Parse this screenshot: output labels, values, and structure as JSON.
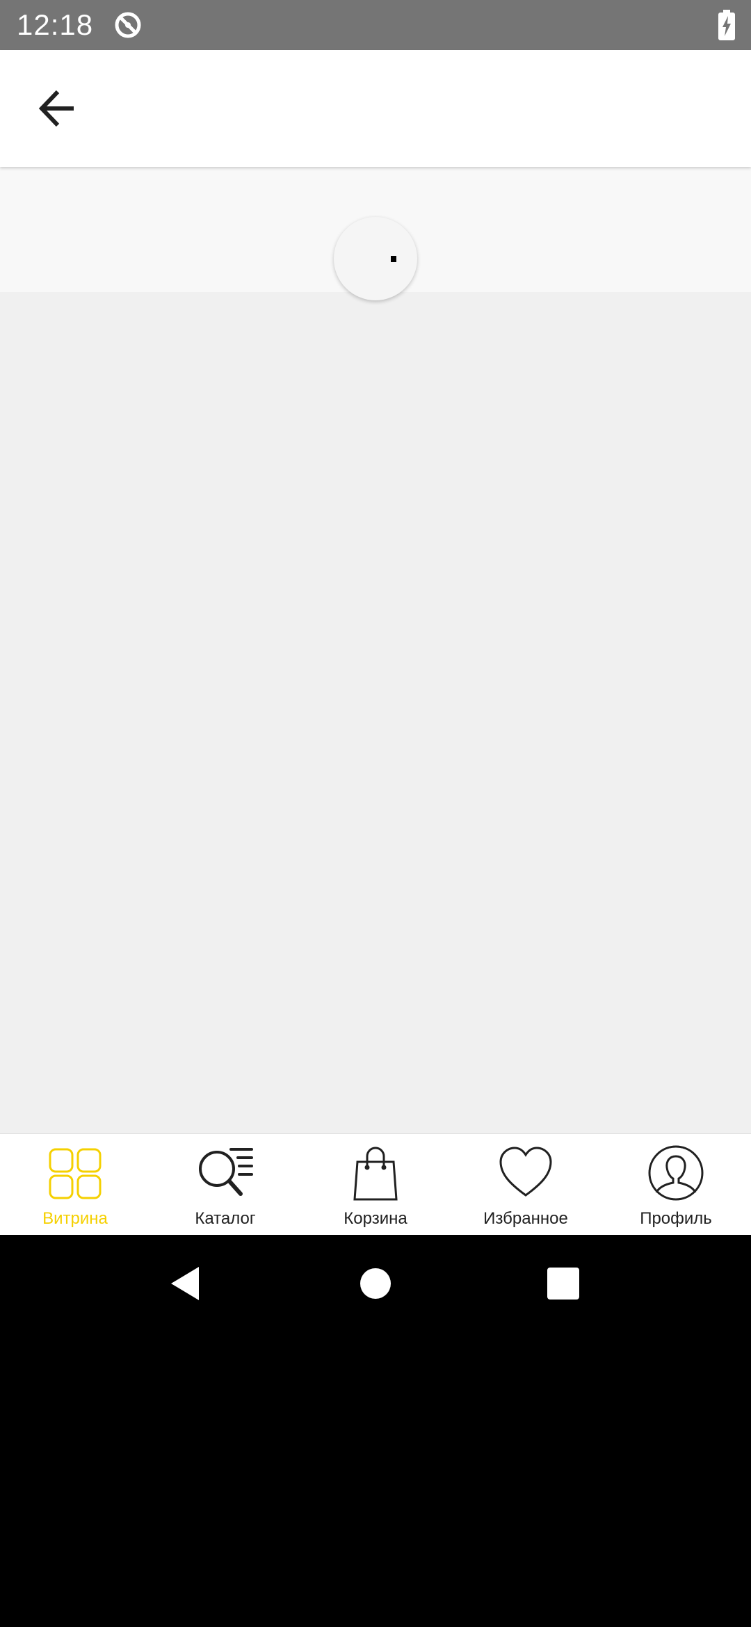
{
  "status_bar": {
    "time": "12:18",
    "icons": [
      "sync-icon",
      "battery-charging-icon"
    ]
  },
  "app_bar": {
    "back_icon": "arrow-left-icon"
  },
  "loading": {
    "indicator": "circular-progress"
  },
  "bottom_nav": {
    "active_color": "#f5d000",
    "items": [
      {
        "label": "Витрина",
        "icon": "grid-icon",
        "active": true
      },
      {
        "label": "Каталог",
        "icon": "catalog-search-icon",
        "active": false
      },
      {
        "label": "Корзина",
        "icon": "shopping-bag-icon",
        "active": false
      },
      {
        "label": "Избранное",
        "icon": "heart-icon",
        "active": false
      },
      {
        "label": "Профиль",
        "icon": "profile-icon",
        "active": false
      }
    ]
  },
  "system_nav": {
    "icons": [
      "back-triangle-icon",
      "home-circle-icon",
      "recents-square-icon"
    ]
  }
}
